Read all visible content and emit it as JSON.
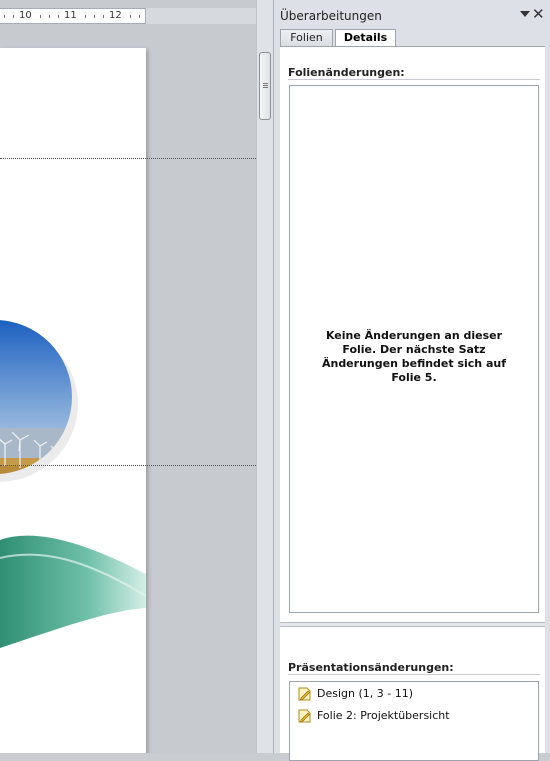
{
  "ruler": {
    "labels": [
      "10",
      "11",
      "12"
    ]
  },
  "pane": {
    "title": "Überarbeitungen",
    "tabs": [
      {
        "label": "Folien",
        "active": false
      },
      {
        "label": "Details",
        "active": true
      }
    ],
    "slide_changes": {
      "header": "Folienänderungen:",
      "message": "Keine Änderungen an dieser Folie. Der nächste Satz Änderungen befindet sich auf Folie 5."
    },
    "presentation_changes": {
      "header": "Präsentationsänderungen:",
      "items": [
        {
          "label": "Design (1, 3 - 11)",
          "icon": "edit-document-icon"
        },
        {
          "label": "Folie 2: Projektübersicht",
          "icon": "edit-document-icon"
        }
      ]
    }
  },
  "colors": {
    "pane_bg": "#dde1e7",
    "editor_bg": "#c7cbd0",
    "water": "#3f9a84",
    "sky": "#2c74c6"
  }
}
